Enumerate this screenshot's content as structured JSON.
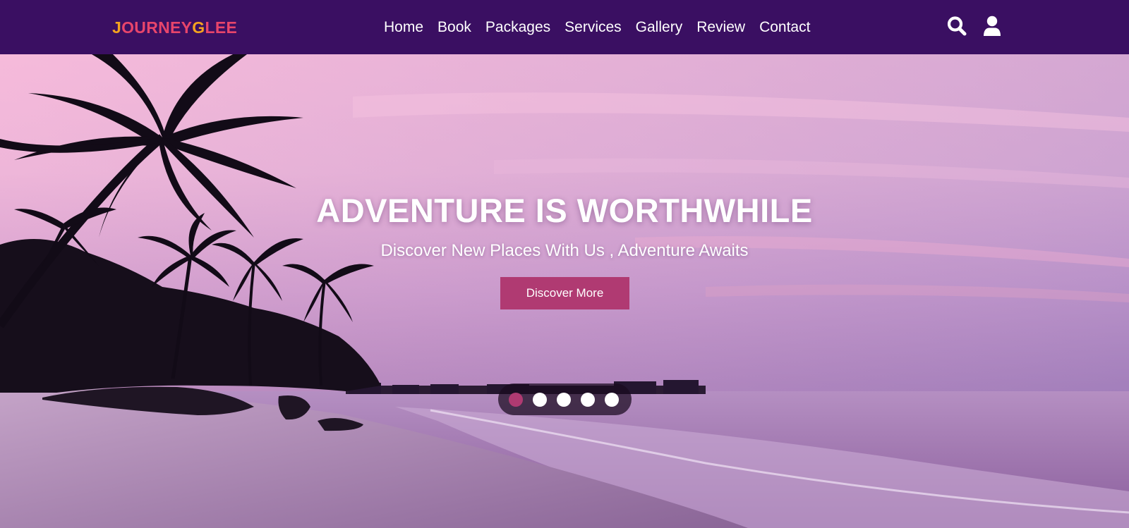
{
  "brand": {
    "parts": [
      {
        "text": "J",
        "color": "#f4a31f"
      },
      {
        "text": "OURNEY",
        "color": "#e8456b"
      },
      {
        "text": "G",
        "color": "#f4a31f"
      },
      {
        "text": "LEE",
        "color": "#e8456b"
      }
    ]
  },
  "nav": {
    "links": [
      "Home",
      "Book",
      "Packages",
      "Services",
      "Gallery",
      "Review",
      "Contact"
    ],
    "icons": [
      "search-icon",
      "user-icon"
    ]
  },
  "hero": {
    "title": "ADVENTURE IS WORTHWHILE",
    "subtitle": "Discover New Places With Us , Adventure Awaits",
    "button_label": "Discover More"
  },
  "carousel": {
    "slide_count": 5,
    "active_index": 0
  },
  "colors": {
    "navbar": "#3a0f62",
    "accent": "#b03a72"
  }
}
